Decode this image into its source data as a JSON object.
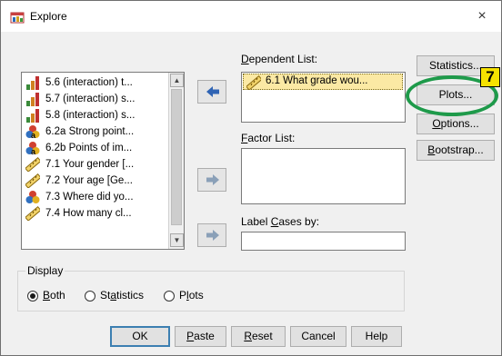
{
  "window": {
    "title": "Explore",
    "close_glyph": "×"
  },
  "variables": [
    {
      "label": "5.6 (interaction) t...",
      "icon": "bar-chart-icon"
    },
    {
      "label": "5.7 (interaction) s...",
      "icon": "bar-chart-icon"
    },
    {
      "label": "5.8 (interaction) s...",
      "icon": "bar-chart-icon"
    },
    {
      "label": "6.2a Strong point...",
      "icon": "nominal-icon"
    },
    {
      "label": "6.2b Points of im...",
      "icon": "nominal-icon"
    },
    {
      "label": "7.1 Your gender [...",
      "icon": "ruler-icon"
    },
    {
      "label": "7.2 Your age [Ge...",
      "icon": "ruler-icon"
    },
    {
      "label": "7.3 Where did yo...",
      "icon": "nominal-icon"
    },
    {
      "label": "7.4 How many cl...",
      "icon": "ruler-icon"
    }
  ],
  "dependent": {
    "label_pre": "",
    "label_u": "D",
    "label_post": "ependent List:",
    "item": "6.1 What grade wou..."
  },
  "factor": {
    "label_u": "F",
    "label_post": "actor List:"
  },
  "label_cases": {
    "label_pre": "Label ",
    "label_u": "C",
    "label_post": "ases by:"
  },
  "side_buttons": {
    "statistics": "Statistics...",
    "plots": "Plots...",
    "options_u": "O",
    "options_post": "ptions...",
    "bootstrap_u": "B",
    "bootstrap_post": "ootstrap..."
  },
  "display": {
    "legend": "Display",
    "both_u": "B",
    "both_post": "oth",
    "statistics_pre": "St",
    "statistics_u": "a",
    "statistics_post": "tistics",
    "plots_pre": "P",
    "plots_u": "l",
    "plots_post": "ots",
    "selected": "Both"
  },
  "bottom_buttons": {
    "ok": "OK",
    "paste_u": "P",
    "paste_post": "aste",
    "reset_u": "R",
    "reset_post": "eset",
    "cancel": "Cancel",
    "help": "Help"
  },
  "annotation": {
    "badge": "7"
  },
  "colors": {
    "highlight": "#fbe9a4",
    "annotation_oval": "#1e9a4a",
    "badge": "#f6e200",
    "default_border": "#3c7fb1"
  }
}
